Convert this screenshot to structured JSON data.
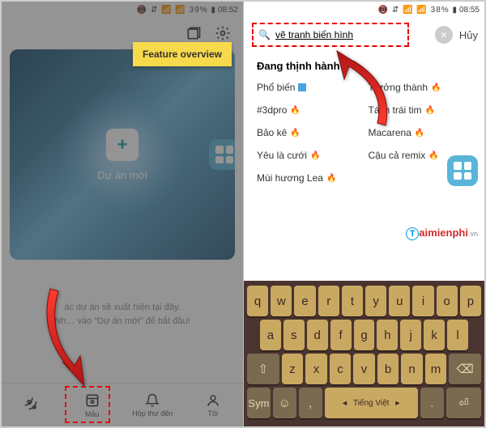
{
  "left": {
    "status": {
      "icons": "📵 ⇵ 📶 📶 39% ▮",
      "time": "08:52"
    },
    "tooltip": "Feature overview",
    "project": {
      "plus": "+",
      "label": "Dự án mới"
    },
    "hint_line1": "ác dự án sẽ xuất hiện tại đây.",
    "hint_line2": "Nh… vào \"Dự án mới\" để bắt đầu!",
    "nav": {
      "edit": "",
      "template": "Mẫu",
      "inbox": "Hộp thư đến",
      "me": "Tôi"
    }
  },
  "right": {
    "status": {
      "icons": "📵 ⇵ 📶 📶 38% ▮",
      "time": "08:55"
    },
    "search": {
      "value": "vẽ tranh biến hình",
      "cancel": "Hủy"
    },
    "trending_title": "Đang thịnh hành",
    "trending": [
      {
        "label": "Phổ biến",
        "icon": "square"
      },
      {
        "label": "Trưởng thành",
        "icon": "flame"
      },
      {
        "label": "#3dpro",
        "icon": "flame"
      },
      {
        "label": "Tách trái tim",
        "icon": "flame"
      },
      {
        "label": "Bảo kê",
        "icon": "flame"
      },
      {
        "label": "Macarena",
        "icon": "flame"
      },
      {
        "label": "Yêu là cưới",
        "icon": "flame"
      },
      {
        "label": "Cậu cả remix",
        "icon": "flame"
      },
      {
        "label": "Mùi hương Lea",
        "icon": "flame"
      }
    ],
    "watermark": {
      "rest": "aimienphi",
      "vn": ".vn"
    },
    "keyboard": {
      "row1": [
        "q",
        "w",
        "e",
        "r",
        "t",
        "y",
        "u",
        "i",
        "o",
        "p"
      ],
      "row2": [
        "a",
        "s",
        "d",
        "f",
        "g",
        "h",
        "j",
        "k",
        "l"
      ],
      "row3_shift": "⇧",
      "row3": [
        "z",
        "x",
        "c",
        "v",
        "b",
        "n",
        "m"
      ],
      "row3_del": "⌫",
      "row4": {
        "sym": "Sym",
        "emoji": "☺",
        "comma": ",",
        "space": "Tiếng Việt",
        "dot": ".",
        "enter": "⏎"
      }
    }
  }
}
